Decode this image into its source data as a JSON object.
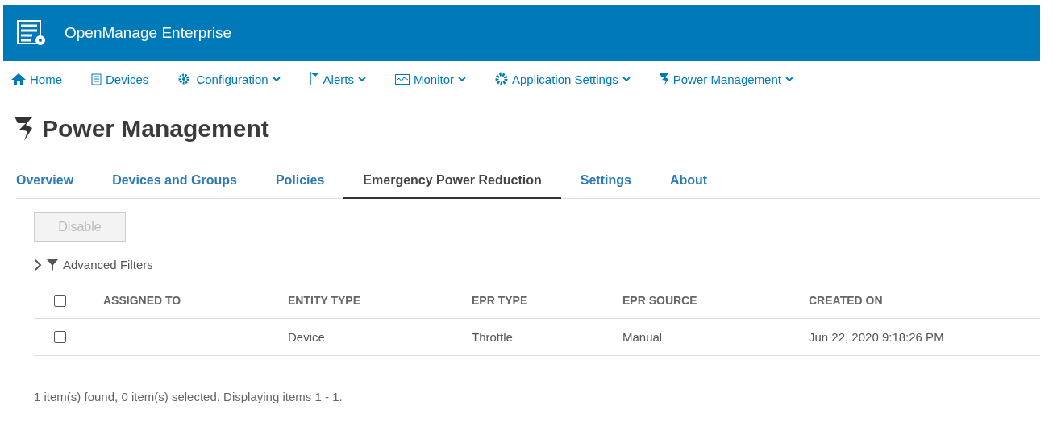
{
  "app": {
    "title": "OpenManage Enterprise"
  },
  "nav": [
    {
      "label": "Home",
      "dropdown": false
    },
    {
      "label": "Devices",
      "dropdown": false
    },
    {
      "label": "Configuration",
      "dropdown": true
    },
    {
      "label": "Alerts",
      "dropdown": true
    },
    {
      "label": "Monitor",
      "dropdown": true
    },
    {
      "label": "Application Settings",
      "dropdown": true
    },
    {
      "label": "Power Management",
      "dropdown": true
    }
  ],
  "page_title": "Power Management",
  "tabs": [
    {
      "label": "Overview",
      "selected": false
    },
    {
      "label": "Devices and Groups",
      "selected": false
    },
    {
      "label": "Policies",
      "selected": false
    },
    {
      "label": "Emergency Power Reduction",
      "selected": true
    },
    {
      "label": "Settings",
      "selected": false
    },
    {
      "label": "About",
      "selected": false
    }
  ],
  "toolbar": {
    "button": {
      "label": "Disable",
      "disabled": true
    }
  },
  "filters": {
    "label": "Advanced Filters",
    "expanded": false
  },
  "table": {
    "select_all": {
      "checked": false
    },
    "columns": [
      "ASSIGNED TO",
      "ENTITY TYPE",
      "EPR TYPE",
      "EPR SOURCE",
      "CREATED ON"
    ],
    "rows": [
      {
        "checked": false,
        "cells": [
          "",
          "Device",
          "Throttle",
          "Manual",
          "Jun 22, 2020 9:18:26 PM"
        ]
      }
    ]
  },
  "status": "1 item(s) found, 0 item(s) selected. Displaying items 1 - 1."
}
